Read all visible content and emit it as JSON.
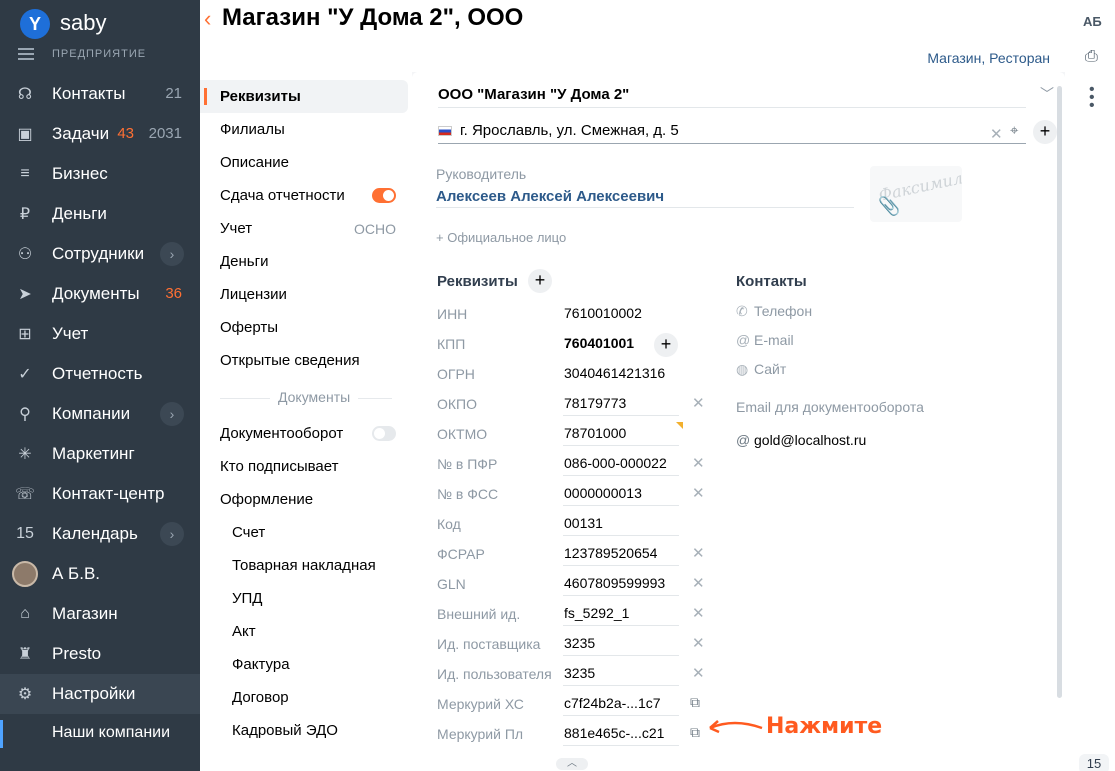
{
  "brand": {
    "logo_letter": "Y",
    "name": "saby",
    "section": "ПРЕДПРИЯТИЕ"
  },
  "nav": [
    {
      "label": "Контакты",
      "icon": "chat-bubble-icon",
      "glyph": "☊",
      "count": "21"
    },
    {
      "label": "Задачи",
      "icon": "tasks-icon",
      "glyph": "▣",
      "count_orange": "43",
      "count": "2031"
    },
    {
      "label": "Бизнес",
      "icon": "business-icon",
      "glyph": "≡"
    },
    {
      "label": "Деньги",
      "icon": "money-icon",
      "glyph": "₽"
    },
    {
      "label": "Сотрудники",
      "icon": "employees-icon",
      "glyph": "⚇",
      "chevron": true
    },
    {
      "label": "Документы",
      "icon": "documents-icon",
      "glyph": "➤",
      "count_orange": "36"
    },
    {
      "label": "Учет",
      "icon": "accounting-icon",
      "glyph": "⊞"
    },
    {
      "label": "Отчетность",
      "icon": "reporting-icon",
      "glyph": "✓"
    },
    {
      "label": "Компании",
      "icon": "companies-icon",
      "glyph": "⚲",
      "chevron": true
    },
    {
      "label": "Маркетинг",
      "icon": "marketing-icon",
      "glyph": "✳"
    },
    {
      "label": "Контакт-центр",
      "icon": "headset-icon",
      "glyph": "☏"
    },
    {
      "label": "Календарь",
      "icon": "calendar-icon",
      "glyph": "15",
      "chevron": true
    },
    {
      "label": "А Б.В.",
      "icon": "avatar",
      "avatar": true
    },
    {
      "label": "Магазин",
      "icon": "store-icon",
      "glyph": "⌂"
    },
    {
      "label": "Presto",
      "icon": "presto-icon",
      "glyph": "♜"
    },
    {
      "label": "Настройки",
      "icon": "settings-icon",
      "glyph": "⚙",
      "active": true
    },
    {
      "label": "Наши компании",
      "sub": true
    }
  ],
  "header": {
    "back": "‹",
    "title": "Магазин \"У Дома 2\", ООО",
    "subtitle": "Магазин, Ресторан"
  },
  "rail": {
    "initials": "АБ",
    "print": "⎙",
    "page": "15"
  },
  "tabs": {
    "items": [
      {
        "label": "Реквизиты",
        "active": true
      },
      {
        "label": "Филиалы"
      },
      {
        "label": "Описание"
      },
      {
        "label": "Сдача отчетности",
        "toggle": "on"
      },
      {
        "label": "Учет",
        "value": "ОСНО"
      },
      {
        "label": "Деньги"
      },
      {
        "label": "Лицензии"
      },
      {
        "label": "Оферты"
      },
      {
        "label": "Открытые сведения"
      }
    ],
    "group_label": "Документы",
    "group_items": [
      {
        "label": "Документооборот",
        "toggle": "off"
      },
      {
        "label": "Кто подписывает"
      },
      {
        "label": "Оформление"
      },
      {
        "label": "Счет",
        "sub": true
      },
      {
        "label": "Товарная накладная",
        "sub": true
      },
      {
        "label": "УПД",
        "sub": true
      },
      {
        "label": "Акт",
        "sub": true
      },
      {
        "label": "Фактура",
        "sub": true
      },
      {
        "label": "Договор",
        "sub": true
      },
      {
        "label": "Кадровый ЭДО",
        "sub": true
      }
    ]
  },
  "org": {
    "name": "ООО \"Магазин \"У Дома 2\"",
    "address": "г. Ярославль, ул. Смежная, д. 5",
    "head_label": "Руководитель",
    "head_name": "Алексеев Алексей Алексеевич",
    "signature_text": "Факсимиле",
    "add_official": "+ Официальное лицо"
  },
  "requisites": {
    "title": "Реквизиты",
    "rows": [
      {
        "label": "ИНН",
        "value": "7610010002"
      },
      {
        "label": "КПП",
        "value": "760401001",
        "bold": true,
        "plus": true
      },
      {
        "label": "ОГРН",
        "value": "3040461421316"
      },
      {
        "label": "ОКПО",
        "value": "78179773",
        "clear": true
      },
      {
        "label": "ОКТМО",
        "value": "78701000",
        "corner": true
      },
      {
        "label": "№ в ПФР",
        "value": "086-000-000022",
        "clear": true
      },
      {
        "label": "№ в ФСС",
        "value": "0000000013",
        "clear": true
      },
      {
        "label": "Код",
        "value": "00131"
      },
      {
        "label": "ФСРАР",
        "value": "123789520654",
        "clear": true
      },
      {
        "label": "GLN",
        "value": "4607809599993",
        "clear": true
      },
      {
        "label": "Внешний ид.",
        "value": "fs_5292_1",
        "clear": true
      },
      {
        "label": "Ид. поставщика",
        "value": "3235",
        "clear": true
      },
      {
        "label": "Ид. пользователя",
        "value": "3235",
        "clear": true
      },
      {
        "label": "Меркурий ХС",
        "value": "c7f24b2a-...1c7",
        "copy": true
      },
      {
        "label": "Меркурий Пл",
        "value": "881e465c-...c21",
        "copy": true
      }
    ]
  },
  "contacts": {
    "title": "Контакты",
    "phone": "Телефон",
    "email": "E-mail",
    "site": "Сайт",
    "edo_label": "Email для документооборота",
    "edo_email": "gold@localhost.ru"
  },
  "hint": {
    "text": "Нажмите"
  },
  "colors": {
    "sidebar": "#2f3a45",
    "accent": "#ff7033",
    "link": "#2d5a8a"
  }
}
